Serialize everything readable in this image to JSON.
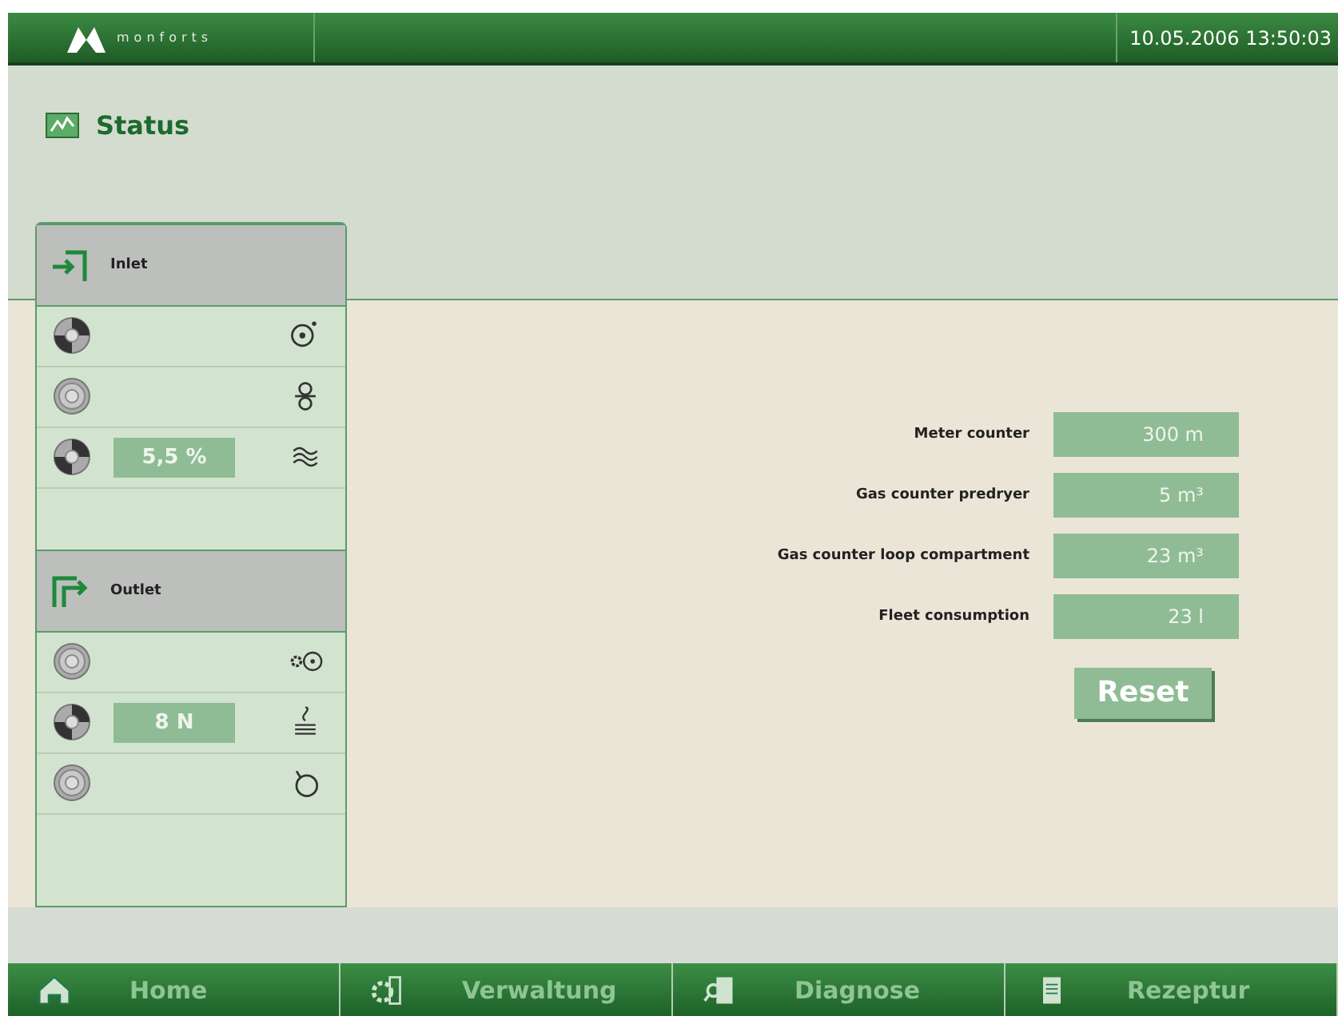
{
  "header": {
    "logo": "monforts",
    "datetime": "10.05.2006 13:50:03"
  },
  "page": {
    "title": "Status"
  },
  "groups": [
    {
      "title": "Inlet",
      "kind": "inlet",
      "rows": [
        {
          "on": true
        },
        {
          "on": false
        },
        {
          "on": true,
          "value": "5,5 %"
        }
      ]
    },
    {
      "title": "Outlet",
      "kind": "outlet",
      "rows": [
        {
          "on": false
        },
        {
          "on": true,
          "value": "8 N"
        },
        {
          "on": false
        }
      ]
    }
  ],
  "counters": [
    {
      "label": "Meter counter",
      "value": "300 m"
    },
    {
      "label": "Gas counter predryer",
      "value": "5 m³"
    },
    {
      "label": "Gas counter loop compartment",
      "value": "23 m³"
    },
    {
      "label": "Fleet consumption",
      "value": "23 l"
    }
  ],
  "reset_button": "Reset",
  "nav": [
    {
      "label": "Home"
    },
    {
      "label": "Verwaltung"
    },
    {
      "label": "Diagnose"
    },
    {
      "label": "Rezeptur"
    }
  ]
}
